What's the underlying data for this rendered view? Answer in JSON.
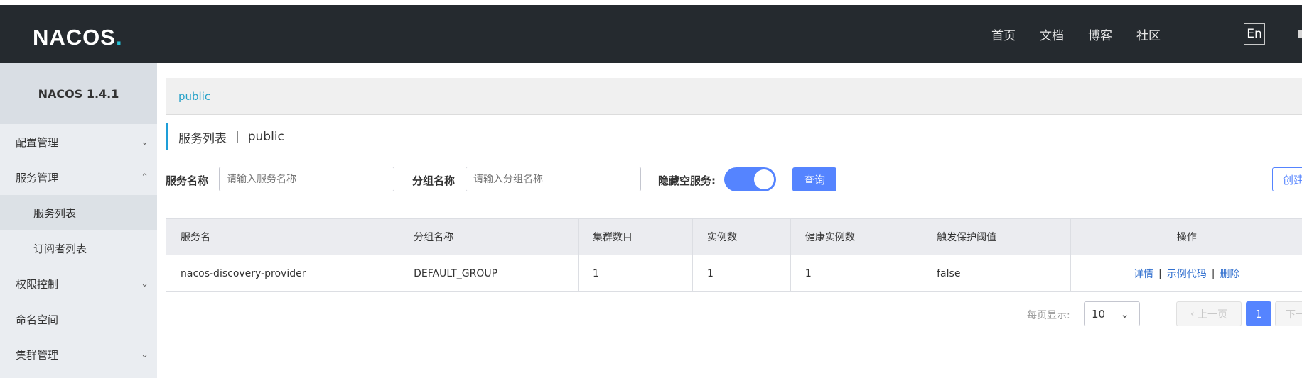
{
  "header": {
    "logo": "NACOS",
    "logo_dot": ".",
    "nav": [
      "首页",
      "文档",
      "博客",
      "社区"
    ],
    "lang_button": "En"
  },
  "sidebar": {
    "title": "NACOS 1.4.1",
    "items": [
      {
        "label": "配置管理",
        "chevron": "chevron-down"
      },
      {
        "label": "服务管理",
        "chevron": "chevron-up"
      },
      {
        "label": "服务列表",
        "sub": true,
        "active": true
      },
      {
        "label": "订阅者列表",
        "sub": true
      },
      {
        "label": "权限控制",
        "chevron": "chevron-down"
      },
      {
        "label": "命名空间"
      },
      {
        "label": "集群管理",
        "chevron": "chevron-down"
      }
    ]
  },
  "breadcrumb": {
    "namespace": "public"
  },
  "page": {
    "title": "服务列表",
    "separator": "|",
    "namespace": "public"
  },
  "search": {
    "service_name_label": "服务名称",
    "service_name_placeholder": "请输入服务名称",
    "group_name_label": "分组名称",
    "group_name_placeholder": "请输入分组名称",
    "hide_empty_label": "隐藏空服务:",
    "hide_empty_on": true,
    "query_button": "查询",
    "create_button": "创建"
  },
  "table": {
    "columns": [
      "服务名",
      "分组名称",
      "集群数目",
      "实例数",
      "健康实例数",
      "触发保护阈值",
      "操作"
    ],
    "rows": [
      {
        "service": "nacos-discovery-provider",
        "group": "DEFAULT_GROUP",
        "clusters": "1",
        "instances": "1",
        "healthy": "1",
        "threshold": "false",
        "actions": [
          "详情",
          "示例代码",
          "删除"
        ]
      }
    ]
  },
  "pagination": {
    "page_size_label": "每页显示:",
    "page_size": "10",
    "prev": "上一页",
    "current": "1",
    "next": "下一页"
  },
  "colors": {
    "header_bg": "#252a2f",
    "accent": "#5584ff",
    "link": "#3270cf",
    "breadcrumb_link": "#25a1c8",
    "sidebar_bg": "#eaedf1"
  }
}
